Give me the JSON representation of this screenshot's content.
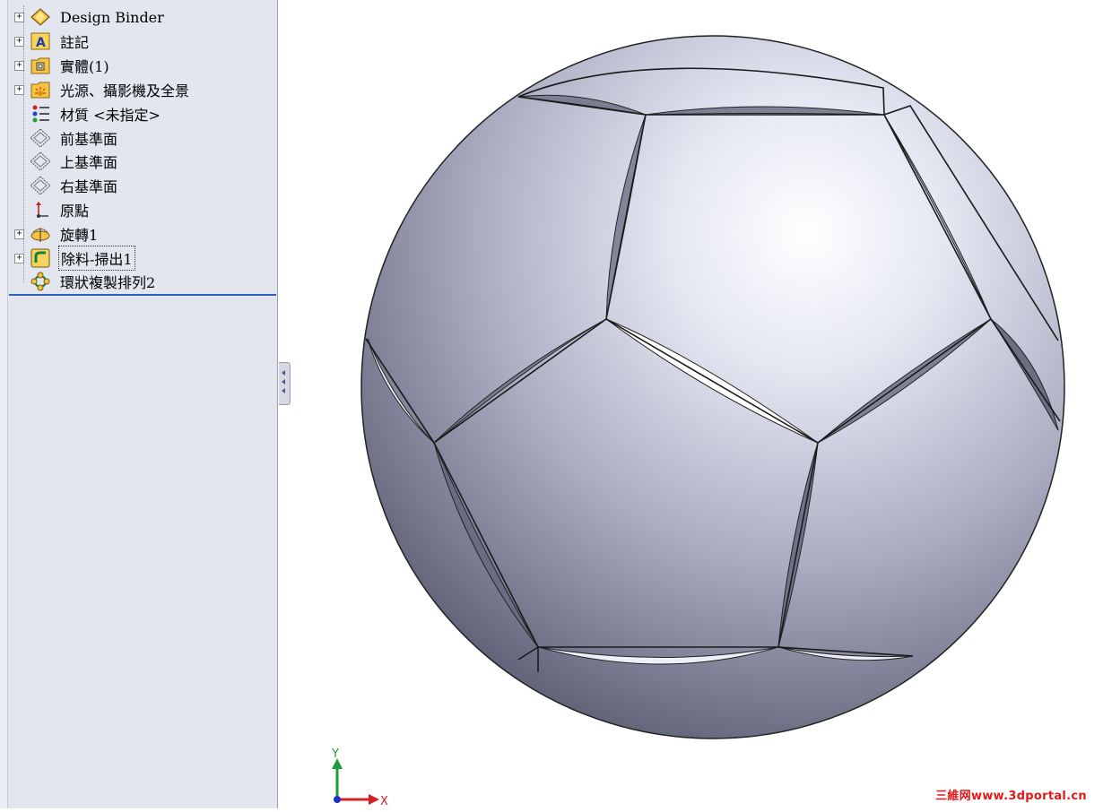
{
  "feature_tree": {
    "items": [
      {
        "label": "Design Binder",
        "icon": "design-binder-icon",
        "expandable": true
      },
      {
        "label": "註記",
        "icon": "annotations-icon",
        "expandable": true
      },
      {
        "label": "實體(1)",
        "icon": "solid-bodies-icon",
        "expandable": true
      },
      {
        "label": "光源、攝影機及全景",
        "icon": "lights-cameras-scene-icon",
        "expandable": true
      },
      {
        "label": "材質 <未指定>",
        "icon": "material-icon",
        "expandable": false
      },
      {
        "label": "前基準面",
        "icon": "plane-icon",
        "expandable": false
      },
      {
        "label": "上基準面",
        "icon": "plane-icon",
        "expandable": false
      },
      {
        "label": "右基準面",
        "icon": "plane-icon",
        "expandable": false
      },
      {
        "label": "原點",
        "icon": "origin-icon",
        "expandable": false
      },
      {
        "label": "旋轉1",
        "icon": "revolve-icon",
        "expandable": true
      },
      {
        "label": "除料-掃出1",
        "icon": "cut-sweep-icon",
        "expandable": true,
        "selected": true
      },
      {
        "label": "環狀複製排列2",
        "icon": "circular-pattern-icon",
        "expandable": false
      }
    ]
  },
  "triad": {
    "y_label": "Y",
    "x_label": "X"
  },
  "watermark": "三維网www.3dportal.cn",
  "colors": {
    "panel_bg": "#e3e6ef",
    "tree_end_line": "#2d63b8",
    "watermark": "#e11919",
    "triad_y": "#1f9a3a",
    "triad_x": "#d32020",
    "triad_z": "#2030c8"
  }
}
